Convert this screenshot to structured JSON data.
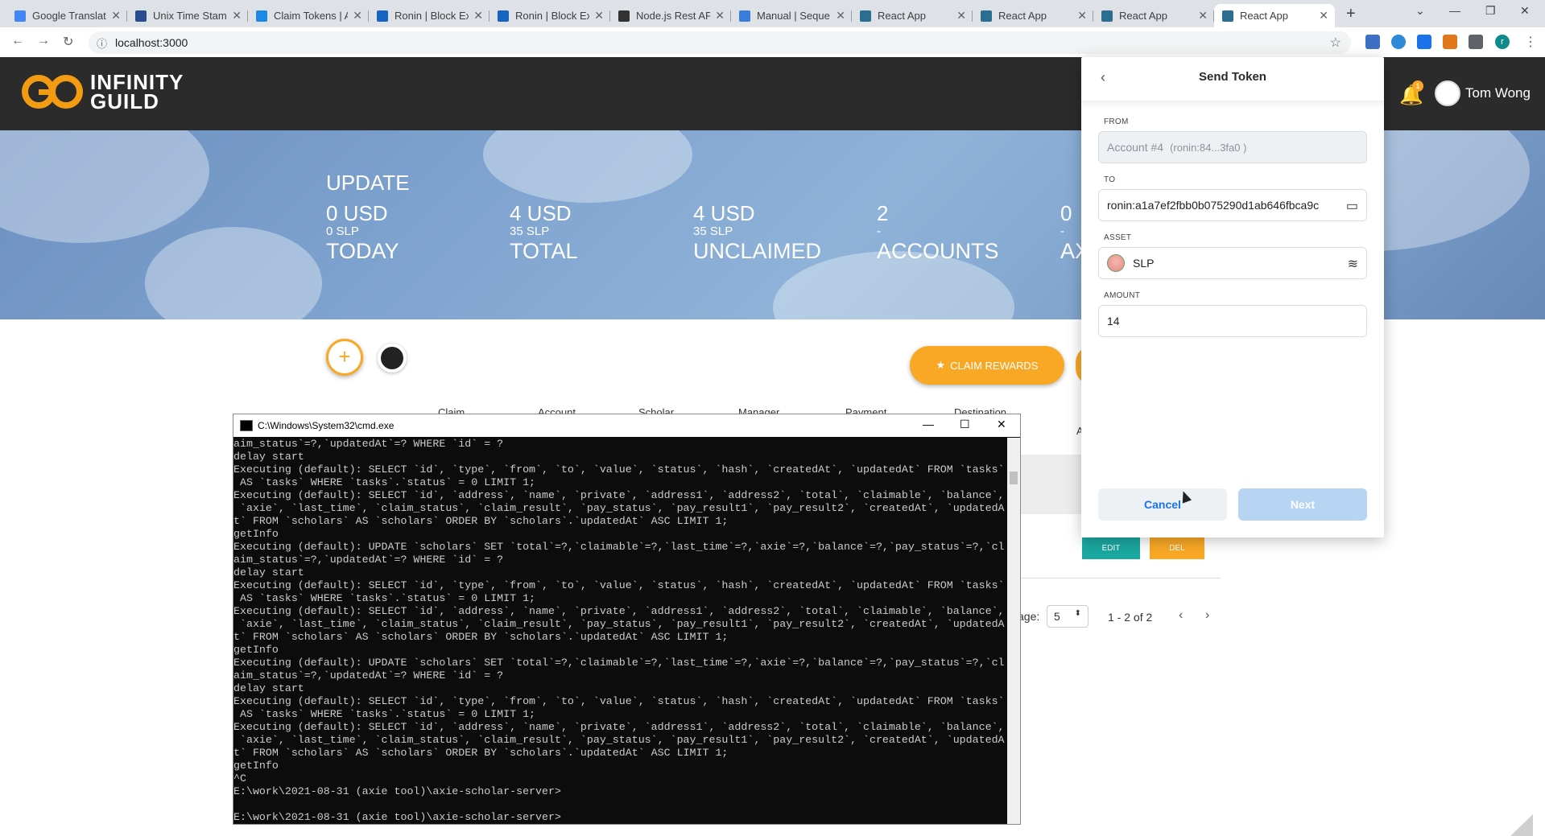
{
  "browser": {
    "tabs": [
      {
        "title": "Google Translate",
        "color": "#4285f4"
      },
      {
        "title": "Unix Time Stamp",
        "color": "#2a4d8f"
      },
      {
        "title": "Claim Tokens | A",
        "color": "#1e88e5"
      },
      {
        "title": "Ronin | Block Ex",
        "color": "#1565c0"
      },
      {
        "title": "Ronin | Block Ex",
        "color": "#1565c0"
      },
      {
        "title": "Node.js Rest AP",
        "color": "#333333"
      },
      {
        "title": "Manual | Seque",
        "color": "#3b7ddd"
      },
      {
        "title": "React App",
        "color": "#2b6e8f"
      },
      {
        "title": "React App",
        "color": "#2b6e8f"
      },
      {
        "title": "React App",
        "color": "#2b6e8f"
      },
      {
        "title": "React App",
        "color": "#2b6e8f"
      }
    ],
    "new_tab_glyph": "+",
    "url": "localhost:3000",
    "profile_initial": "r"
  },
  "app": {
    "logo_line1": "INFINITY",
    "logo_line2": "GUILD",
    "user_name": "Tom Wong",
    "notification_count": "1"
  },
  "banner": {
    "title": "UPDATE",
    "stats": [
      {
        "usd": "0 USD",
        "slp": "0 SLP",
        "label": "TODAY"
      },
      {
        "usd": "4 USD",
        "slp": "35 SLP",
        "label": "TOTAL"
      },
      {
        "usd": "4 USD",
        "slp": "35 SLP",
        "label": "UNCLAIMED"
      },
      {
        "usd": "2",
        "slp": "-",
        "label": "ACCOUNTS"
      },
      {
        "usd": "0",
        "slp": "-",
        "label": "AX"
      }
    ]
  },
  "toolbar": {
    "claim_label": "CLAIM REWARDS",
    "table_headers": [
      "Claim",
      "Account",
      "Scholar",
      "Manager",
      "Payment",
      "Destination"
    ],
    "partial_header": "A",
    "edit_label": "EDIT",
    "del_label": "DEL",
    "rows_per_page_label": "age:",
    "rows_per_page_value": "5",
    "page_range": "1 - 2 of 2"
  },
  "cmd": {
    "title": "C:\\Windows\\System32\\cmd.exe",
    "lines": [
      "aim_status`=?,`updatedAt`=? WHERE `id` = ?",
      "delay start",
      "Executing (default): SELECT `id`, `type`, `from`, `to`, `value`, `status`, `hash`, `createdAt`, `updatedAt` FROM `tasks`",
      " AS `tasks` WHERE `tasks`.`status` = 0 LIMIT 1;",
      "Executing (default): SELECT `id`, `address`, `name`, `private`, `address1`, `address2`, `total`, `claimable`, `balance`,",
      " `axie`, `last_time`, `claim_status`, `claim_result`, `pay_status`, `pay_result1`, `pay_result2`, `createdAt`, `updatedA",
      "t` FROM `scholars` AS `scholars` ORDER BY `scholars`.`updatedAt` ASC LIMIT 1;",
      "getInfo",
      "Executing (default): UPDATE `scholars` SET `total`=?,`claimable`=?,`last_time`=?,`axie`=?,`balance`=?,`pay_status`=?,`cl",
      "aim_status`=?,`updatedAt`=? WHERE `id` = ?",
      "delay start",
      "Executing (default): SELECT `id`, `type`, `from`, `to`, `value`, `status`, `hash`, `createdAt`, `updatedAt` FROM `tasks`",
      " AS `tasks` WHERE `tasks`.`status` = 0 LIMIT 1;",
      "Executing (default): SELECT `id`, `address`, `name`, `private`, `address1`, `address2`, `total`, `claimable`, `balance`,",
      " `axie`, `last_time`, `claim_status`, `claim_result`, `pay_status`, `pay_result1`, `pay_result2`, `createdAt`, `updatedA",
      "t` FROM `scholars` AS `scholars` ORDER BY `scholars`.`updatedAt` ASC LIMIT 1;",
      "getInfo",
      "Executing (default): UPDATE `scholars` SET `total`=?,`claimable`=?,`last_time`=?,`axie`=?,`balance`=?,`pay_status`=?,`cl",
      "aim_status`=?,`updatedAt`=? WHERE `id` = ?",
      "delay start",
      "Executing (default): SELECT `id`, `type`, `from`, `to`, `value`, `status`, `hash`, `createdAt`, `updatedAt` FROM `tasks`",
      " AS `tasks` WHERE `tasks`.`status` = 0 LIMIT 1;",
      "Executing (default): SELECT `id`, `address`, `name`, `private`, `address1`, `address2`, `total`, `claimable`, `balance`,",
      " `axie`, `last_time`, `claim_status`, `claim_result`, `pay_status`, `pay_result1`, `pay_result2`, `createdAt`, `updatedA",
      "t` FROM `scholars` AS `scholars` ORDER BY `scholars`.`updatedAt` ASC LIMIT 1;",
      "getInfo",
      "^C",
      "E:\\work\\2021-08-31 (axie tool)\\axie-scholar-server>",
      "",
      "E:\\work\\2021-08-31 (axie tool)\\axie-scholar-server>"
    ]
  },
  "send_token": {
    "title": "Send Token",
    "from_label": "FROM",
    "from_account": "Account #4",
    "from_address": "(ronin:84...3fa0 )",
    "to_label": "TO",
    "to_value": "ronin:a1a7ef2fbb0b075290d1ab646fbca9c",
    "asset_label": "ASSET",
    "asset_value": "SLP",
    "amount_label": "AMOUNT",
    "amount_value": "14",
    "cancel_label": "Cancel",
    "next_label": "Next"
  }
}
